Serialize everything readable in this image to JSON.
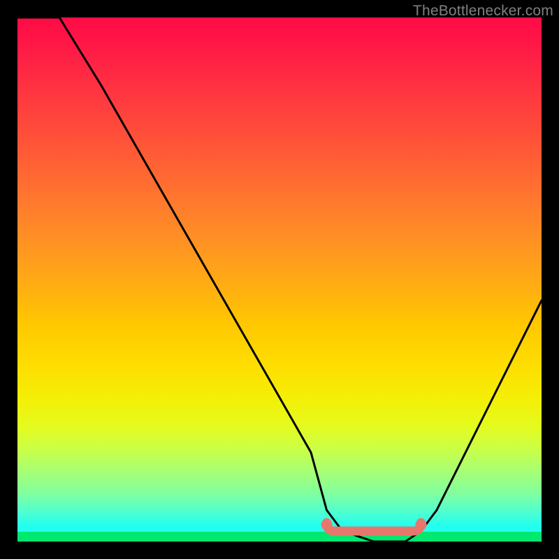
{
  "watermark": "TheBottlenecker.com",
  "chart_data": {
    "type": "line",
    "title": "",
    "xlabel": "",
    "ylabel": "",
    "xlim": [
      0,
      100
    ],
    "ylim": [
      0,
      100
    ],
    "series": [
      {
        "name": "bottleneck-curve",
        "x": [
          0,
          8,
          16,
          24,
          32,
          40,
          48,
          56,
          59,
          62,
          68,
          74,
          77,
          80,
          86,
          92,
          100
        ],
        "values": [
          100,
          100,
          87,
          73,
          59,
          45,
          31,
          17,
          6,
          2,
          0,
          0,
          2,
          6,
          18,
          30,
          46
        ]
      }
    ],
    "markers": [
      {
        "name": "marker-dot-left",
        "x": 59,
        "y": 3.2
      },
      {
        "name": "marker-dot-right",
        "x": 77,
        "y": 3.2
      }
    ],
    "marker_bar": {
      "x_start": 59,
      "x_end": 77,
      "y": 2.0
    },
    "gradient_colors_top_to_bottom": [
      "#ff0b46",
      "#ff7d2c",
      "#ffc700",
      "#f4ef06",
      "#9aff83",
      "#23ffef",
      "#00e86f"
    ]
  }
}
